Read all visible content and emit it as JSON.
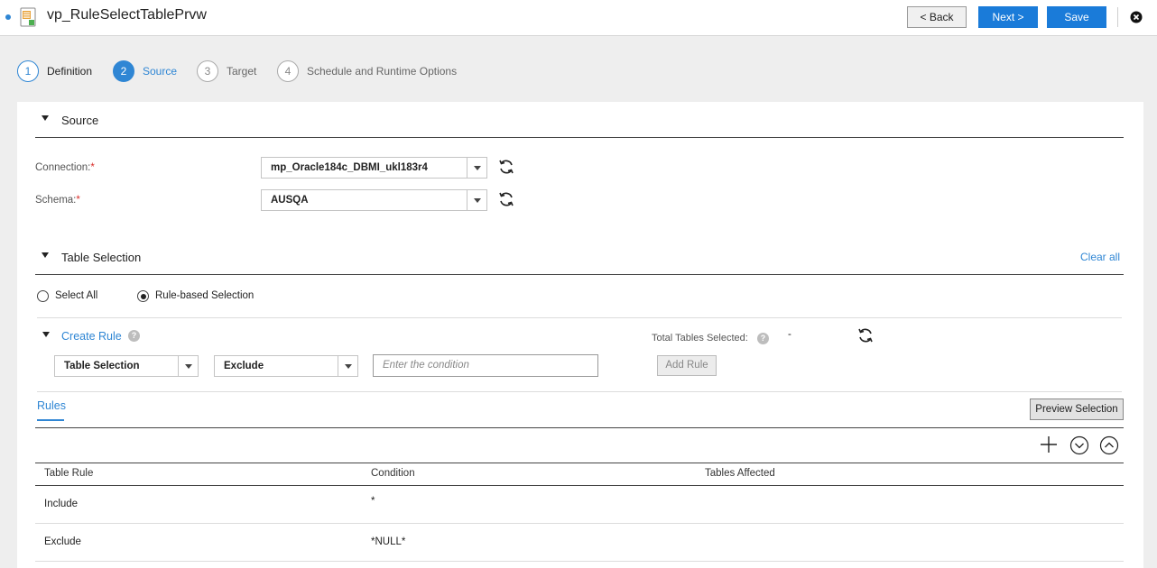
{
  "app": {
    "title": "vp_RuleSelectTablePrvw"
  },
  "toolbar": {
    "back_label": "< Back",
    "next_label": "Next >",
    "save_label": "Save"
  },
  "steps": [
    {
      "num": "1",
      "label": "Definition",
      "state": "done"
    },
    {
      "num": "2",
      "label": "Source",
      "state": "active"
    },
    {
      "num": "3",
      "label": "Target",
      "state": "pending"
    },
    {
      "num": "4",
      "label": "Schedule and Runtime Options",
      "state": "pending"
    }
  ],
  "source": {
    "title": "Source",
    "connection_label": "Connection:",
    "connection_value": "mp_Oracle184c_DBMI_ukl183r4",
    "schema_label": "Schema:",
    "schema_value": "AUSQA",
    "required_mark": "*"
  },
  "table_selection": {
    "title": "Table Selection",
    "clear_all": "Clear all",
    "options": [
      {
        "label": "Select All",
        "selected": false
      },
      {
        "label": "Rule-based Selection",
        "selected": true
      }
    ]
  },
  "create_rule": {
    "title": "Create Rule",
    "help": "?",
    "total_label": "Total Tables Selected:",
    "total_value": "-",
    "scope_select": "Table Selection",
    "action_select": "Exclude",
    "condition_placeholder": "Enter the condition",
    "add_rule_label": "Add Rule"
  },
  "rules": {
    "tab_label": "Rules",
    "preview_label": "Preview Selection",
    "columns": [
      "Table Rule",
      "Condition",
      "Tables Affected"
    ],
    "rows": [
      {
        "rule": "Include",
        "condition": "*",
        "affected": ""
      },
      {
        "rule": "Exclude",
        "condition": "*NULL*",
        "affected": ""
      }
    ]
  },
  "colors": {
    "accent": "#2f86d4",
    "primary_button": "#1a7bd9",
    "required": "#d9302c"
  },
  "icons": [
    "document-icon",
    "close-icon",
    "refresh-icon",
    "help-icon",
    "add-icon",
    "move-down-icon",
    "move-up-icon"
  ]
}
